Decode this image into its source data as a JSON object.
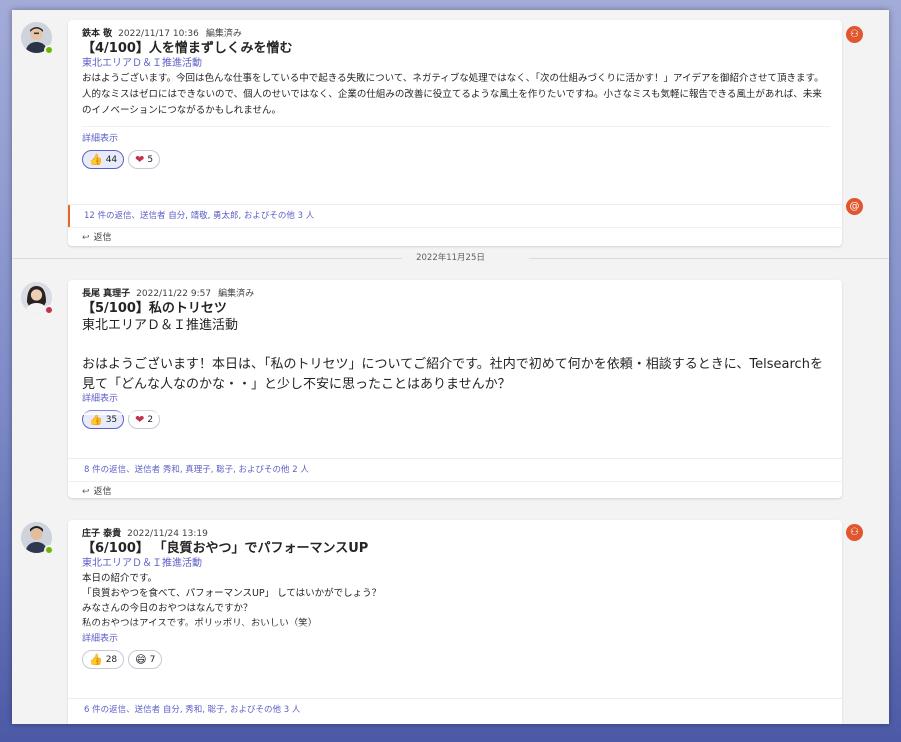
{
  "posts": [
    {
      "author": "鉄本 敬",
      "time": "2022/11/17 10:36",
      "edited": "編集済み",
      "title": "【4/100】人を憎まずしくみを憎む",
      "tag": "東北エリアＤ＆Ｉ推進活動",
      "body": "おはようございます。今回は色んな仕事をしている中で起きる失敗について、ネガティブな処理ではなく、「次の仕組みづくりに活かす！」アイデアを御紹介させて頂きます。人的なミスはゼロにはできないので、個人のせいではなく、企業の仕組みの改善に役立てるような風土を作りたいですね。小さなミスも気軽に報告できる風土があれば、未来のイノベーションにつながるかもしれません。",
      "detail": "詳細表示",
      "reactions": [
        {
          "icon": "thumbs-up-icon",
          "glyph": "👍",
          "count": "44"
        },
        {
          "icon": "heart-icon",
          "glyph": "❤",
          "count": "5"
        }
      ],
      "replies": "12 件の返信、送信者 自分, 靖敬, 勇太郎, およびその他 3 人",
      "reply_label": "返信"
    },
    {
      "author": "長尾 真理子",
      "time": "2022/11/22 9:57",
      "edited": "編集済み",
      "title": "【5/100】私のトリセツ",
      "tag": "東北エリアＤ＆Ｉ推進活動",
      "body": "おはようございます！本日は、「私のトリセツ」についてご紹介です。社内で初めて何かを依頼・相談するときに、Telsearchを見て「どんな人なのかな・・」と少し不安に思ったことはありませんか？",
      "detail": "詳細表示",
      "reactions": [
        {
          "icon": "thumbs-up-icon",
          "glyph": "👍",
          "count": "35"
        },
        {
          "icon": "heart-icon",
          "glyph": "❤",
          "count": "2"
        }
      ],
      "replies": "8 件の返信、送信者 秀和, 真理子, 聡子, およびその他 2 人",
      "reply_label": "返信"
    },
    {
      "author": "庄子 泰貴",
      "time": "2022/11/24 13:19",
      "title": "【6/100】 「良質おやつ」でパフォーマンスUP",
      "tag": "東北エリアＤ＆Ｉ推進活動",
      "body_lines": [
        "本日の紹介です。",
        "「良質おやつを食べて、パフォーマンスUP」 してはいかがでしょう？",
        "みなさんの今日のおやつはなんですか？",
        "私のおやつはアイスです。ポリッポリ、おいしい（笑）"
      ],
      "detail": "詳細表示",
      "reactions": [
        {
          "icon": "thumbs-up-icon",
          "glyph": "👍",
          "count": "28"
        },
        {
          "icon": "grinning-face-icon",
          "glyph": "😄",
          "count": "7"
        }
      ],
      "replies": "6 件の返信、送信者 自分, 秀和, 聡子, およびその他 3 人"
    }
  ],
  "date_separator": "2022年11月25日",
  "colors": {
    "accent": "#5b5fc7",
    "badge": "#e0562f",
    "presence_available": "#6bb700",
    "presence_busy": "#c4314b"
  }
}
